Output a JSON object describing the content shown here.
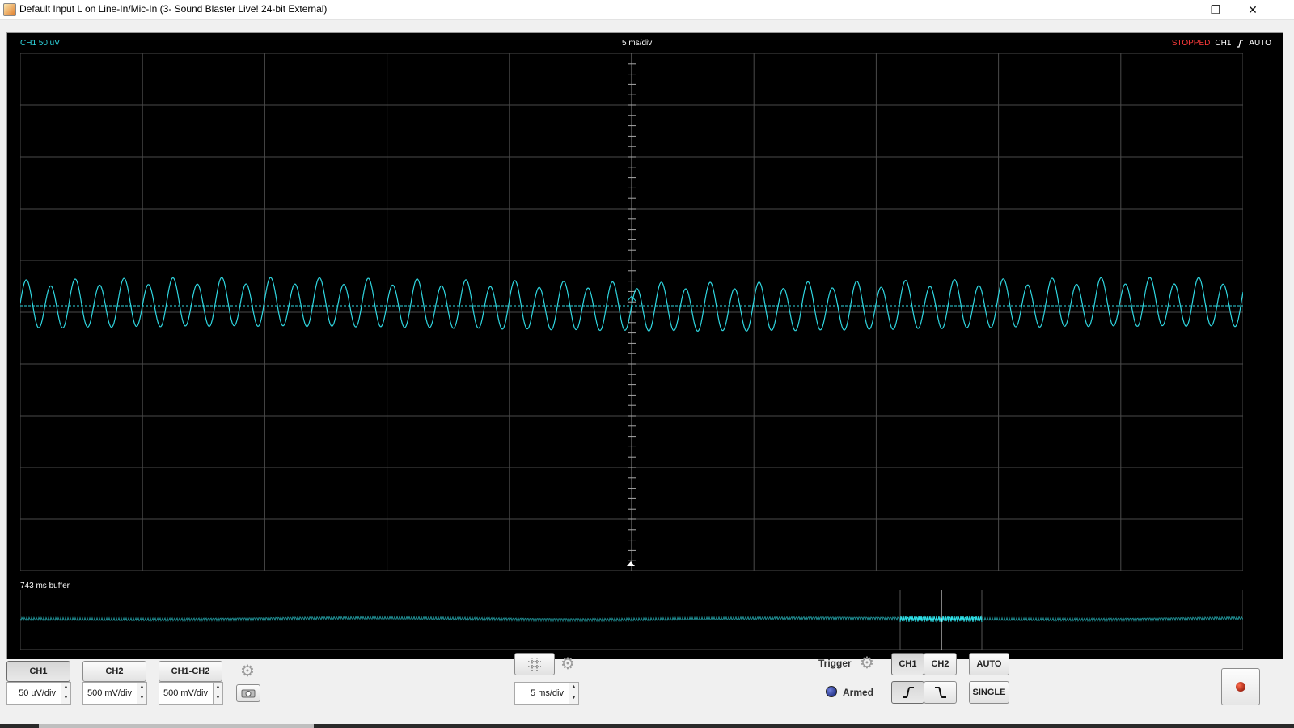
{
  "window": {
    "title": "Default Input L on Line-In/Mic-In (3- Sound Blaster Live! 24-bit External)",
    "minimize_glyph": "—",
    "maximize_glyph": "❐",
    "close_glyph": "✕"
  },
  "scope": {
    "channel_label": "CH1 50 uV",
    "timebase_label": "5 ms/div",
    "status": "STOPPED",
    "trigger_channel": "CH1",
    "trigger_mode": "AUTO",
    "buffer_label": "743 ms buffer",
    "trace_color": "#2fd6e0",
    "status_color": "#ff3b3b",
    "grid_color": "#4a4a4a"
  },
  "controls": {
    "ch1_label": "CH1",
    "ch2_label": "CH2",
    "ch1_ch2_label": "CH1-CH2",
    "ch1_scale": "50 uV/div",
    "ch2_scale": "500 mV/div",
    "diff_scale": "500 mV/div",
    "timebase": "5 ms/div",
    "trigger_label": "Trigger",
    "trigger_ch1": "CH1",
    "trigger_ch2": "CH2",
    "auto_label": "AUTO",
    "single_label": "SINGLE",
    "armed_label": "Armed"
  }
}
